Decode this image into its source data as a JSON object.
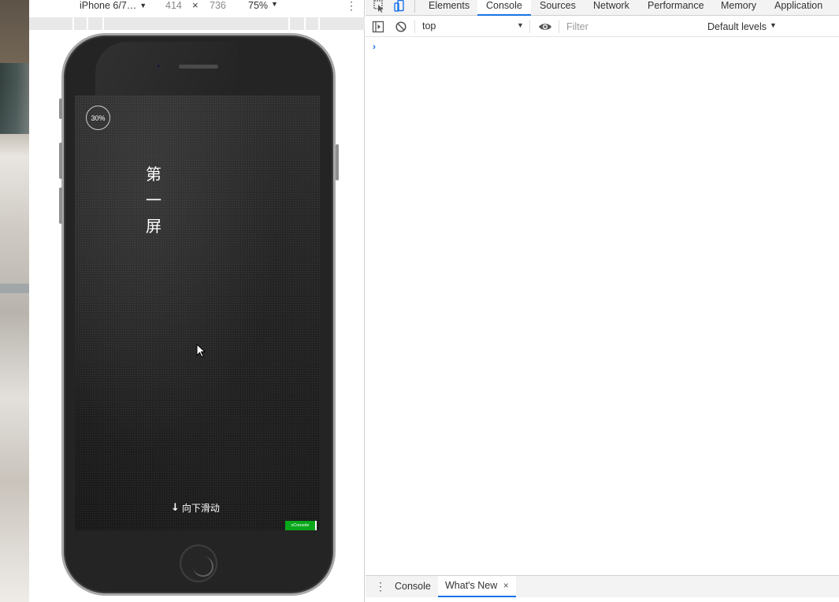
{
  "emulation_toolbar": {
    "device": "iPhone 6/7…",
    "width": "414",
    "times": "×",
    "height": "736",
    "zoom": "75%",
    "more": "⋮"
  },
  "phone_screen": {
    "progress": "30%",
    "title_chars": [
      "第",
      "一",
      "屏"
    ],
    "swipe_arrow": "↓",
    "swipe_text": "向下滑动",
    "vconsole_label": "vConsole"
  },
  "devtools": {
    "tabs": [
      "Elements",
      "Console",
      "Sources",
      "Network",
      "Performance",
      "Memory",
      "Application"
    ],
    "active_tab": "Console",
    "console_bar": {
      "context": "top",
      "filter_placeholder": "Filter",
      "levels": "Default levels",
      "levels_arrow": "▼",
      "context_arrow": "▼"
    },
    "prompt": "›",
    "drawer": {
      "more": "⋮",
      "tabs": [
        "Console",
        "What's New"
      ],
      "close": "×"
    }
  },
  "colors": {
    "accent": "#1a73e8",
    "vconsole_green": "#08a81a",
    "phone_body": "#242424"
  }
}
